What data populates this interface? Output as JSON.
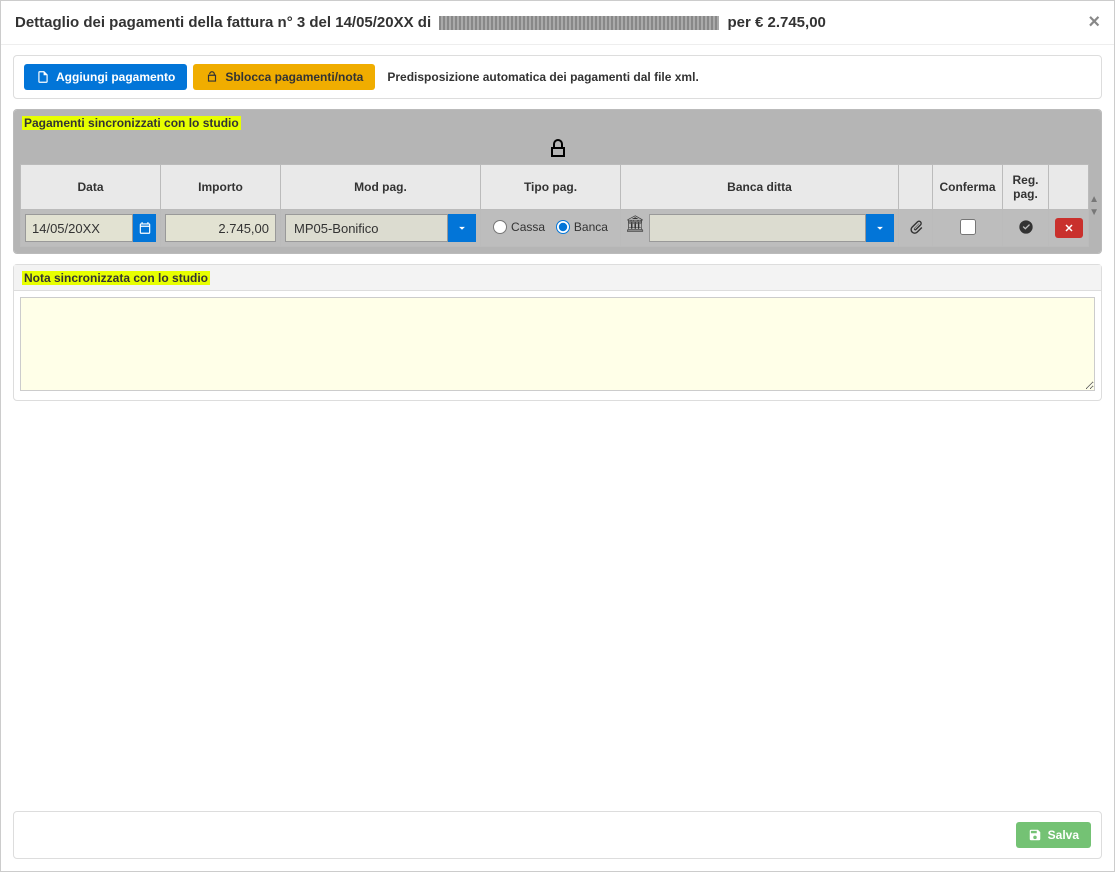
{
  "header": {
    "title_prefix": "Dettaglio dei pagamenti della fattura n° 3 del 14/05/20XX di",
    "title_suffix": "per € 2.745,00"
  },
  "toolbar": {
    "add_label": "Aggiungi pagamento",
    "unlock_label": "Sblocca pagamenti/nota",
    "info_text": "Predisposizione automatica dei pagamenti dal file xml."
  },
  "payments_panel": {
    "heading": "Pagamenti sincronizzati con lo studio",
    "columns": {
      "date": "Data",
      "amount": "Importo",
      "paymode": "Mod pag.",
      "paytype": "Tipo pag.",
      "bank": "Banca ditta",
      "attach": "",
      "confirm": "Conferma",
      "regpag": "Reg. pag.",
      "del": ""
    },
    "row": {
      "date": "14/05/20XX",
      "amount": "2.745,00",
      "paymode": "MP05-Bonifico",
      "type_cassa": "Cassa",
      "type_banca": "Banca",
      "bank": ""
    }
  },
  "note_panel": {
    "heading": "Nota sincronizzata con lo studio",
    "value": ""
  },
  "footer": {
    "save_label": "Salva"
  }
}
